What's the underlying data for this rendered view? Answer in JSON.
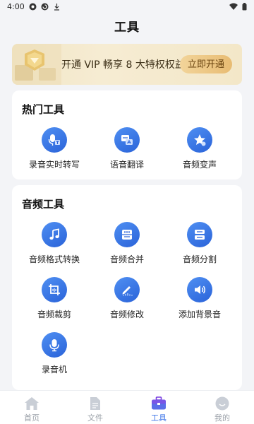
{
  "status_bar": {
    "time": "4:00"
  },
  "header": {
    "title": "工具"
  },
  "vip": {
    "text": "开通 VIP 畅享 8 大特权权益",
    "button_label": "立即开通"
  },
  "hot_tools": {
    "title": "热门工具",
    "items": [
      {
        "label": "录音实时转写",
        "icon": "mic-text-icon"
      },
      {
        "label": "语音翻译",
        "icon": "translate-icon"
      },
      {
        "label": "音频变声",
        "icon": "star-voice-icon"
      }
    ]
  },
  "audio_tools": {
    "title": "音频工具",
    "items": [
      {
        "label": "音频格式转换",
        "icon": "music-note-icon"
      },
      {
        "label": "音频合并",
        "icon": "merge-icon"
      },
      {
        "label": "音频分割",
        "icon": "split-icon"
      },
      {
        "label": "音频裁剪",
        "icon": "crop-icon"
      },
      {
        "label": "音频修改",
        "icon": "edit-icon"
      },
      {
        "label": "添加背景音",
        "icon": "volume-icon"
      },
      {
        "label": "录音机",
        "icon": "microphone-icon"
      }
    ]
  },
  "nav": {
    "items": [
      {
        "label": "首页",
        "icon": "home-icon",
        "active": false
      },
      {
        "label": "文件",
        "icon": "file-icon",
        "active": false
      },
      {
        "label": "工具",
        "icon": "toolbox-icon",
        "active": true
      },
      {
        "label": "我的",
        "icon": "profile-icon",
        "active": false
      }
    ]
  },
  "colors": {
    "accent": "#3f76e8",
    "icon_bg": "#2f6de0",
    "vip_bg": "#f4e9cf",
    "vip_button": "#ecc47e"
  }
}
